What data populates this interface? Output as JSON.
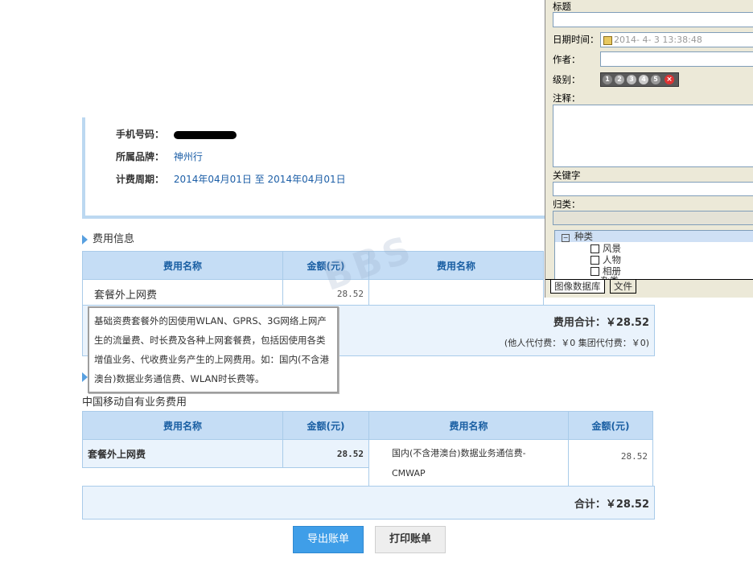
{
  "account": {
    "phone_label": "手机号码：",
    "brand_label": "所属品牌：",
    "brand_value": "神州行",
    "period_label": "计费周期：",
    "period_value": "2014年04月01日 至 2014年04月01日"
  },
  "fee_info": {
    "title": "费用信息",
    "headers": [
      "费用名称",
      "金额(元)",
      "费用名称"
    ],
    "rows": [
      {
        "name": "套餐外上网费",
        "amount": "28.52"
      }
    ],
    "total": "费用合计：￥28.52",
    "sub_total": "(他人代付费：￥0 集团代付费：￥0)"
  },
  "tooltip": {
    "text": "基础资费套餐外的因使用WLAN、GPRS、3G网络上网产生的流量费、时长费及各种上网套餐费，包括因使用各类增值业务、代收费业务产生的上网费用。如：国内(不含港澳台)数据业务通信费、WLAN时长费等。"
  },
  "own_business": {
    "title": "中国移动自有业务费用",
    "headers": [
      "费用名称",
      "金额(元)",
      "费用名称",
      "金额(元)"
    ],
    "left_row": {
      "name": "套餐外上网费",
      "amount": "28.52"
    },
    "right_row": {
      "name": "国内(不含港澳台)数据业务通信费-CMWAP",
      "amount": "28.52"
    },
    "total": "合计：￥28.52"
  },
  "buttons": {
    "export": "导出账单",
    "print": "打印账单"
  },
  "watermark": "BBS",
  "panel": {
    "title_label": "标题",
    "date_label": "日期时间：",
    "date_value": "2014- 4- 3 13:38:48",
    "author_label": "作者：",
    "level_label": "级别：",
    "level_dots": [
      "1",
      "2",
      "3",
      "4",
      "5"
    ],
    "note_label": "注释：",
    "keyword_label": "关键字",
    "category_label": "归类：",
    "tree_root": "种类",
    "tree_items": [
      "风景",
      "人物",
      "相册",
      "杂类"
    ],
    "tabs": [
      "图像数据库",
      "文件"
    ]
  },
  "colors": {
    "accent": "#3f9ee8",
    "header_bg": "#c5ddf5",
    "link": "#1d5fa7"
  }
}
